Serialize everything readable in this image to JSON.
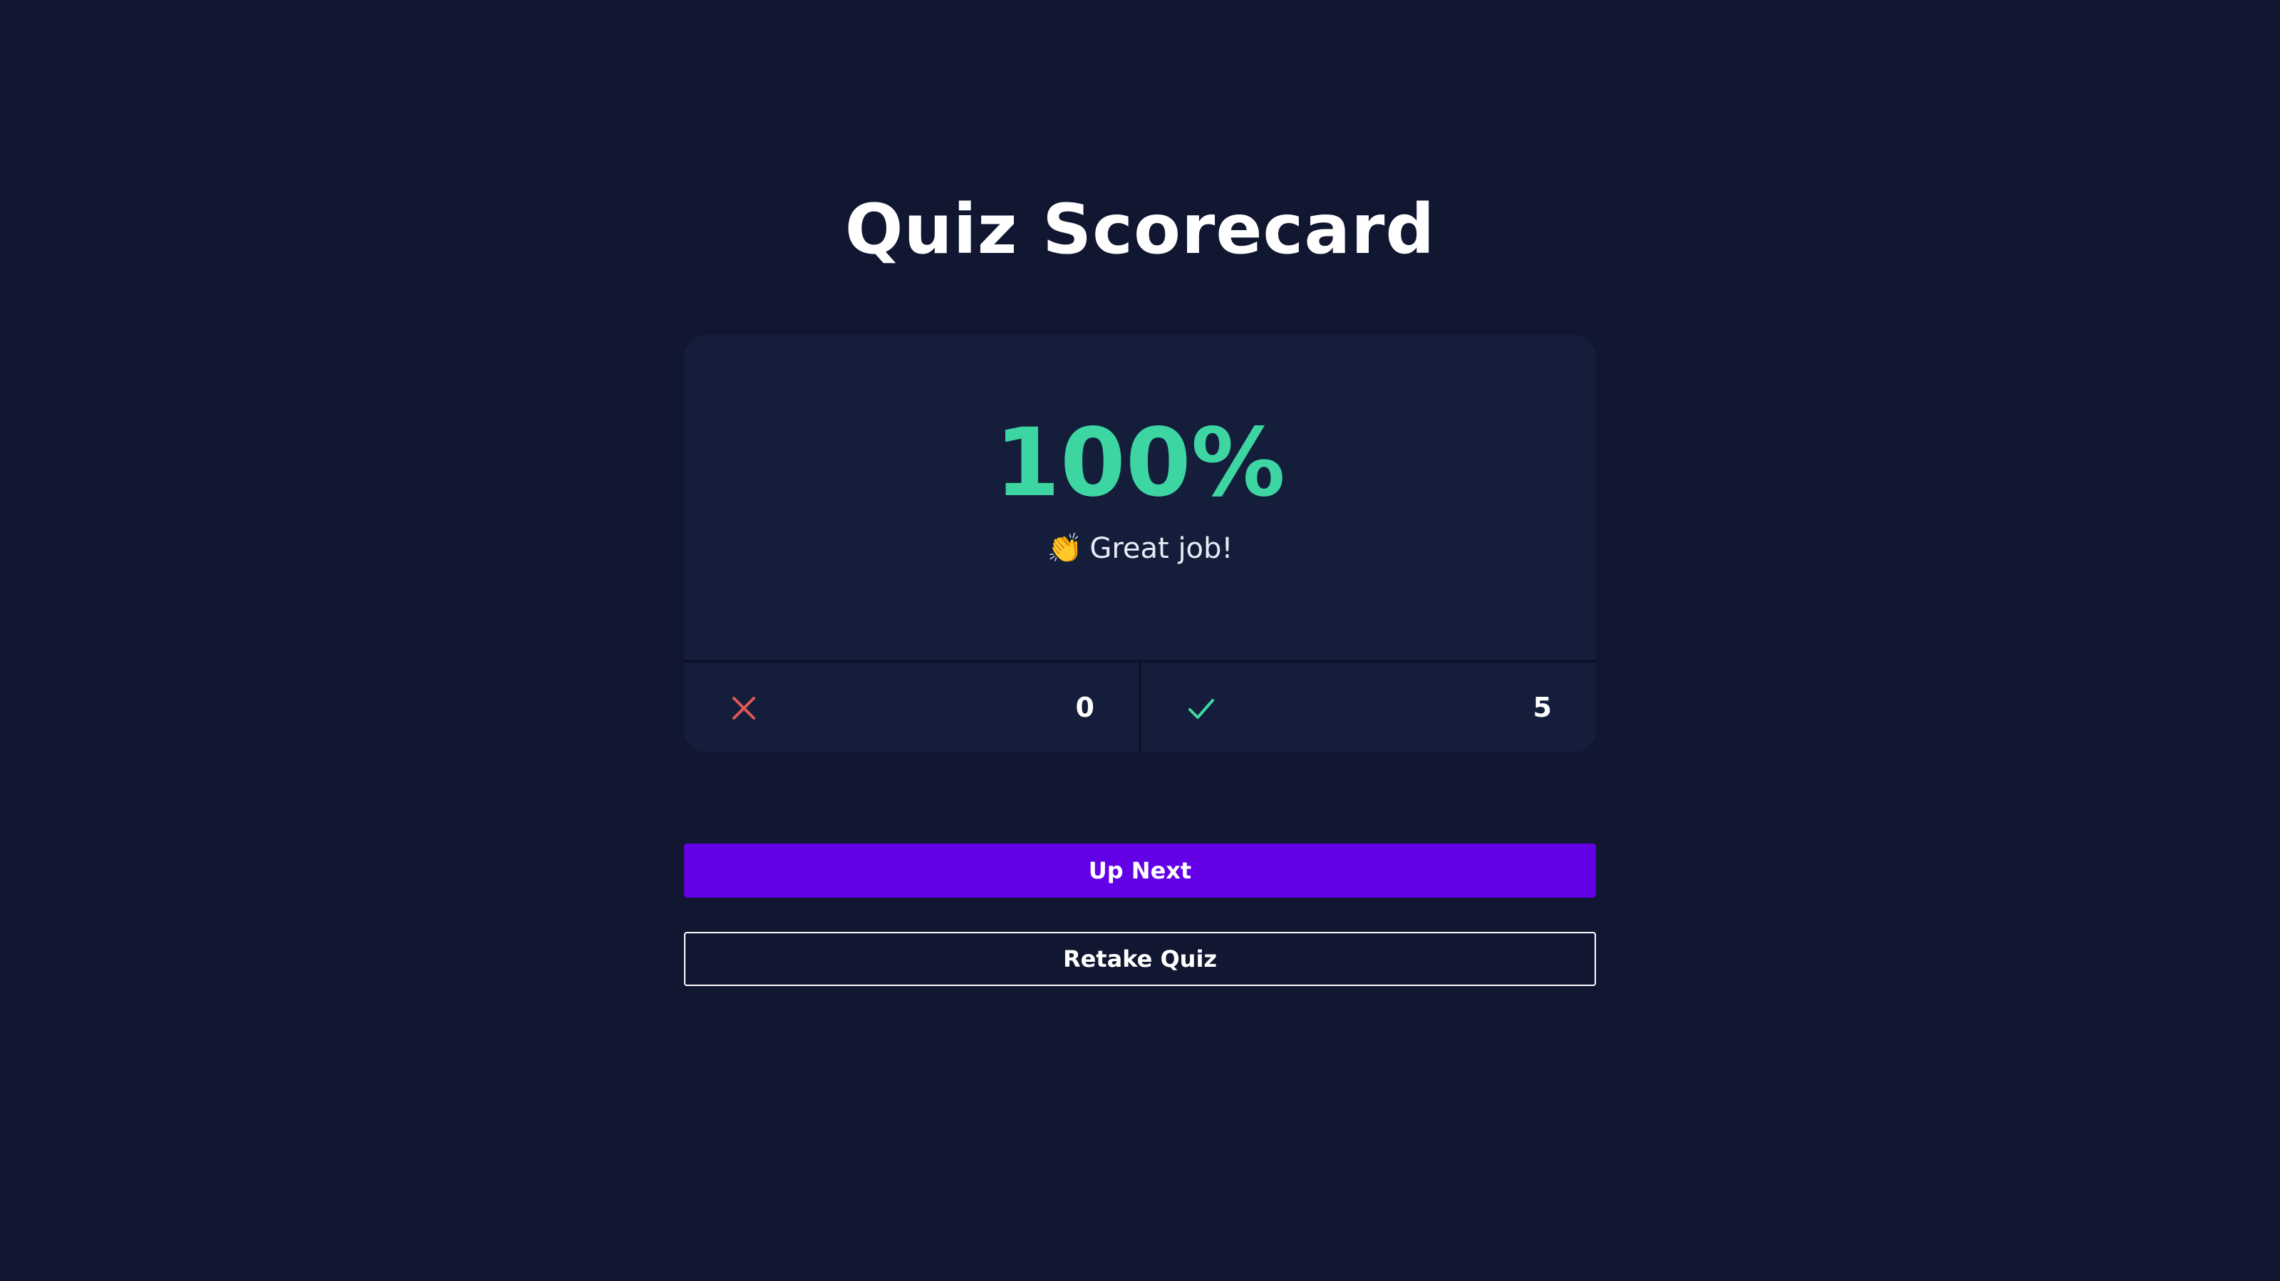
{
  "page": {
    "title": "Quiz Scorecard"
  },
  "score": {
    "percent_label": "100%",
    "percent_value": 100,
    "emoji": "👏",
    "message": "Great job!"
  },
  "stats": {
    "incorrect": {
      "icon": "x-icon",
      "count": "0",
      "color": "#e05757"
    },
    "correct": {
      "icon": "check-icon",
      "count": "5",
      "color": "#3dd6a3"
    }
  },
  "actions": {
    "up_next_label": "Up Next",
    "retake_label": "Retake Quiz"
  },
  "colors": {
    "background": "#111631",
    "card": "#141e3b",
    "accent_score": "#3dd6a3",
    "primary_button": "#6200e6"
  }
}
